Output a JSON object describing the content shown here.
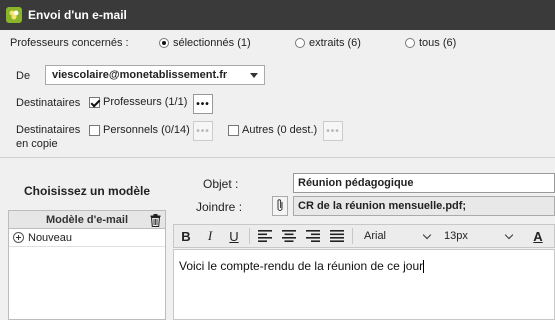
{
  "window": {
    "title": "Envoi d'un e-mail"
  },
  "recipients_filter": {
    "label": "Professeurs concernés :",
    "options": [
      {
        "label": "sélectionnés (1)",
        "selected": true
      },
      {
        "label": "extraits (6)",
        "selected": false
      },
      {
        "label": "tous (6)",
        "selected": false
      }
    ]
  },
  "from": {
    "label": "De",
    "value": "viescolaire@monetablissement.fr"
  },
  "destinataires": {
    "label": "Destinataires",
    "professeurs": {
      "label": "Professeurs (1/1)",
      "checked": true
    },
    "more_label": "•••"
  },
  "copie": {
    "label_line1": "Destinataires",
    "label_line2": "en copie",
    "personnels": {
      "label": "Personnels (0/14)",
      "checked": false
    },
    "autres": {
      "label": "Autres (0 dest.)",
      "checked": false
    },
    "more_label": "•••"
  },
  "models": {
    "section_title": "Choisissez un modèle",
    "column_header": "Modèle d'e-mail",
    "items": [
      {
        "label": "Nouveau"
      }
    ]
  },
  "message": {
    "subject_label": "Objet :",
    "subject_value": "Réunion pédagogique",
    "attach_label": "Joindre :",
    "attach_value": "CR de la réunion mensuelle.pdf;",
    "body": "Voici le compte-rendu de la réunion de ce jour"
  },
  "toolbar": {
    "bold": "B",
    "italic": "I",
    "underline": "U",
    "font": "Arial",
    "size": "13px",
    "text_color_glyph": "A"
  },
  "colors": {
    "titlebar": "#3a3a3a",
    "app_icon": "#8ab42a"
  }
}
